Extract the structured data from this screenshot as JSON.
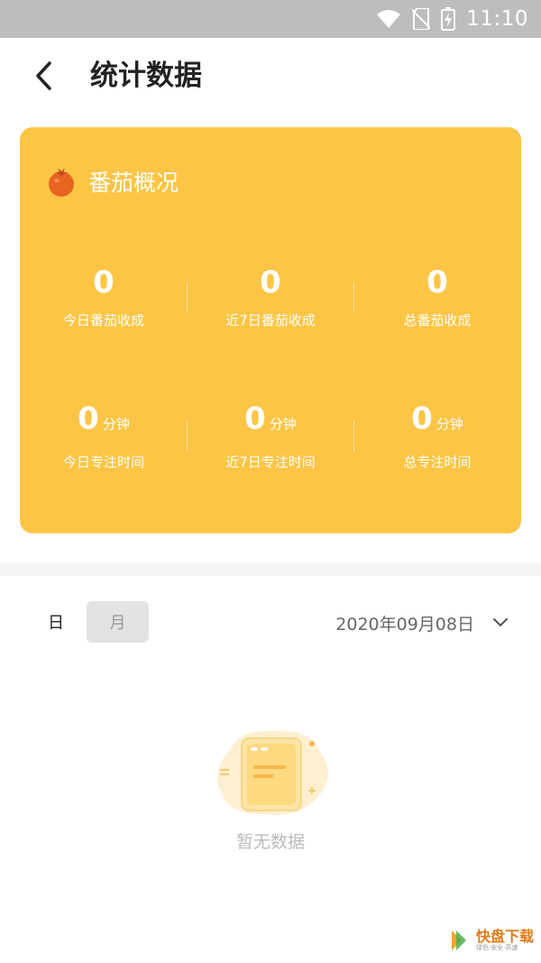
{
  "status_bar": {
    "time": "11:10",
    "icons": [
      "wifi-icon",
      "no-sim-icon",
      "battery-charging-icon"
    ]
  },
  "header": {
    "back_icon": "chevron-left-icon",
    "title": "统计数据"
  },
  "overview": {
    "icon": "tomato-icon",
    "title": "番茄概况",
    "accent_color": "#fdc546",
    "stats": [
      {
        "value": "0",
        "unit": "",
        "label": "今日番茄收成"
      },
      {
        "value": "0",
        "unit": "",
        "label": "近7日番茄收成"
      },
      {
        "value": "0",
        "unit": "",
        "label": "总番茄收成"
      },
      {
        "value": "0",
        "unit": "分钟",
        "label": "今日专注时间"
      },
      {
        "value": "0",
        "unit": "分钟",
        "label": "近7日专注时间"
      },
      {
        "value": "0",
        "unit": "分钟",
        "label": "总专注时间"
      }
    ]
  },
  "period_toggle": {
    "day_label": "日",
    "month_label": "月",
    "selected": "日"
  },
  "date_picker": {
    "value": "2020年09月08日",
    "icon": "chevron-down-icon"
  },
  "empty_state": {
    "icon": "empty-document-icon",
    "text": "暂无数据"
  },
  "watermark": {
    "text": "快盘下载",
    "subtext": "绿色·安全·高速"
  }
}
